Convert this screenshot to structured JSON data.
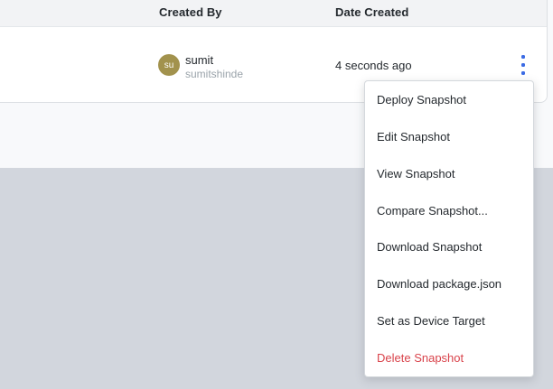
{
  "table": {
    "columns": {
      "created_by": "Created By",
      "date_created": "Date Created"
    },
    "row": {
      "avatar_initials": "su",
      "name": "sumit",
      "username": "sumitshinde",
      "date_created": "4 seconds ago",
      "actions_icon": "vertical-ellipsis-icon"
    }
  },
  "menu": {
    "items": [
      {
        "label": "Deploy Snapshot"
      },
      {
        "label": "Edit Snapshot"
      },
      {
        "label": "View Snapshot"
      },
      {
        "label": "Compare Snapshot..."
      },
      {
        "label": "Download Snapshot"
      },
      {
        "label": "Download package.json"
      },
      {
        "label": "Set as Device Target"
      },
      {
        "label": "Delete Snapshot"
      }
    ]
  },
  "colors": {
    "accent_blue": "#3b6be4",
    "avatar_olive": "#a2924d",
    "danger_red": "#d9434b",
    "header_bg": "#f2f3f5",
    "page_bg": "#f8f9fb",
    "lower_band": "#d2d6dd"
  }
}
